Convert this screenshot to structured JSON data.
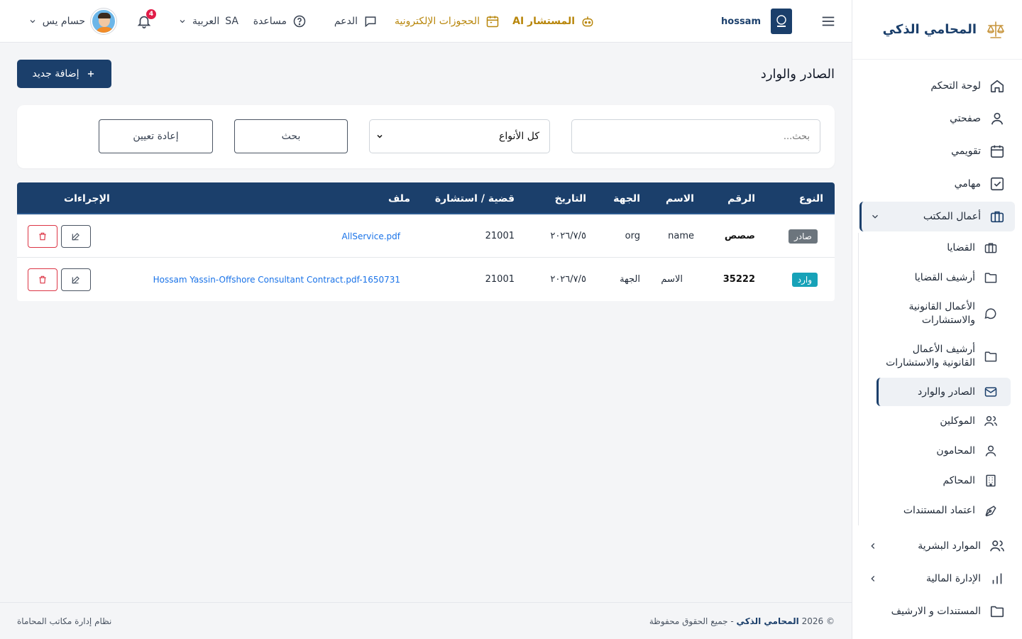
{
  "sidebar": {
    "brand": "المحامي الذكي",
    "items": [
      {
        "label": "لوحة التحكم",
        "icon": "home-icon"
      },
      {
        "label": "صفحتي",
        "icon": "user-icon"
      },
      {
        "label": "تقويمي",
        "icon": "calendar-icon"
      },
      {
        "label": "مهامي",
        "icon": "checkbox-icon"
      },
      {
        "label": "أعمال المكتب",
        "icon": "briefcase-icon"
      }
    ],
    "sub_items": [
      {
        "label": "القضايا",
        "icon": "briefcase-icon"
      },
      {
        "label": "أرشيف القضايا",
        "icon": "folder-icon"
      },
      {
        "label": "الأعمال القانونية والاستشارات",
        "icon": "chat-icon"
      },
      {
        "label": "أرشيف الأعمال القانونية والاستشارات",
        "icon": "folder-icon"
      },
      {
        "label": "الصادر والوارد",
        "icon": "mail-icon"
      },
      {
        "label": "الموكلين",
        "icon": "users-icon"
      },
      {
        "label": "المحامون",
        "icon": "user-icon"
      },
      {
        "label": "المحاكم",
        "icon": "building-icon"
      },
      {
        "label": "اعتماد المستندات",
        "icon": "pen-icon"
      }
    ],
    "bottom_items": [
      {
        "label": "الموارد البشرية",
        "icon": "users-icon"
      },
      {
        "label": "الإدارة المالية",
        "icon": "bar-chart-icon"
      },
      {
        "label": "المستندات و الارشيف",
        "icon": "folder-icon"
      }
    ]
  },
  "topbar": {
    "user_name": "hossam",
    "ai_label": "المستشار AI",
    "bookings_label": "الحجوزات الإلكترونية",
    "support_label": "الدعم",
    "help_label": "مساعدة",
    "lang_code": "SA",
    "lang_label": "العربية",
    "notifications_count": "4",
    "profile_name": "حسام يس"
  },
  "page": {
    "title": "الصادر والوارد",
    "add_button": "إضافة جديد"
  },
  "filters": {
    "search_placeholder": "بحث...",
    "type_select": "كل الأنواع",
    "search_button": "بحث",
    "reset_button": "إعادة تعيين"
  },
  "table": {
    "headers": {
      "type": "النوع",
      "number": "الرقم",
      "name": "الاسم",
      "party": "الجهة",
      "date": "التاريخ",
      "case": "قضية / استشارة",
      "file": "ملف",
      "actions": "الإجراءات"
    },
    "rows": [
      {
        "type": "صادر",
        "type_color": "#6c757d",
        "number": "صصص",
        "name": "name",
        "party": "org",
        "date": "٢٠٢٦/٧/٥",
        "case": "21001",
        "file": "AllService.pdf"
      },
      {
        "type": "وارد",
        "type_color": "#17a2b8",
        "number": "35222",
        "name": "الاسم",
        "party": "الجهة",
        "date": "٢٠٢٦/٧/٥",
        "case": "21001",
        "file": "Hossam Yassin-Offshore Consultant Contract.pdf-1650731"
      }
    ]
  },
  "footer": {
    "copyright_prefix": "© 2026",
    "brand": "المحامي الذكي",
    "rights": "- جميع الحقوق محفوظة",
    "system": "نظام إدارة مكاتب المحاماة"
  }
}
